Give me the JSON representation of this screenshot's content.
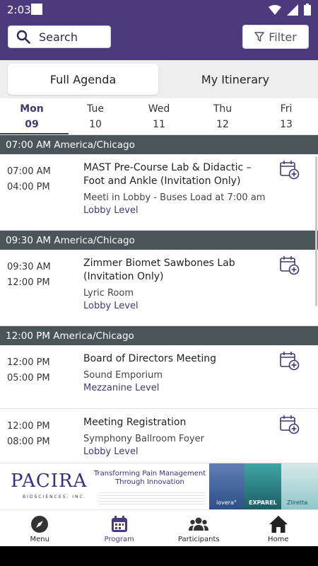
{
  "status_bar": {
    "time": "2:03"
  },
  "header": {
    "search_label": "Search",
    "filter_label": "Filter"
  },
  "tabs": [
    {
      "label": "Full Agenda"
    },
    {
      "label": "My Itinerary"
    }
  ],
  "days": [
    {
      "name": "Mon",
      "date": "09"
    },
    {
      "name": "Tue",
      "date": "10"
    },
    {
      "name": "Wed",
      "date": "11"
    },
    {
      "name": "Thu",
      "date": "12"
    },
    {
      "name": "Fri",
      "date": "13"
    }
  ],
  "agenda": {
    "groups": [
      {
        "header": "07:00 AM America/Chicago",
        "items": [
          {
            "start": "07:00 AM",
            "end": "04:00 PM",
            "title": "MAST Pre-Course Lab & Didactic – Foot and Ankle (Invitation Only)",
            "location": "Meeti in Lobby - Buses Load at 7:00 am",
            "level": "Lobby Level"
          }
        ]
      },
      {
        "header": "09:30 AM America/Chicago",
        "items": [
          {
            "start": "09:30 AM",
            "end": "12:00 PM",
            "title": "Zimmer Biomet Sawbones Lab (Invitation Only)",
            "location": "Lyric Room",
            "level": "Lobby Level"
          }
        ]
      },
      {
        "header": "12:00 PM America/Chicago",
        "items": [
          {
            "start": "12:00 PM",
            "end": "05:00 PM",
            "title": "Board of Directors Meeting",
            "location": "Sound Emporium",
            "level": "Mezzanine Level"
          },
          {
            "start": "12:00 PM",
            "end": "08:00 PM",
            "title": "Meeting Registration",
            "location": "Symphony Ballroom Foyer",
            "level": "Lobby Level"
          }
        ]
      }
    ]
  },
  "banner": {
    "logo": "PACIRA",
    "logo_sub": "BIOSCIENCES, INC.",
    "tagline": "Transforming Pain Management Through Innovation",
    "products": [
      "iovera°",
      "EXPAREL",
      "Zilretta"
    ]
  },
  "bottom_nav": [
    {
      "label": "Menu",
      "icon": "compass-icon"
    },
    {
      "label": "Program",
      "icon": "calendar-icon"
    },
    {
      "label": "Participants",
      "icon": "people-icon"
    },
    {
      "label": "Home",
      "icon": "home-icon"
    }
  ],
  "colors": {
    "brand": "#4b3b7c",
    "group_header": "#4a5557",
    "accent": "#3f3a6f"
  }
}
